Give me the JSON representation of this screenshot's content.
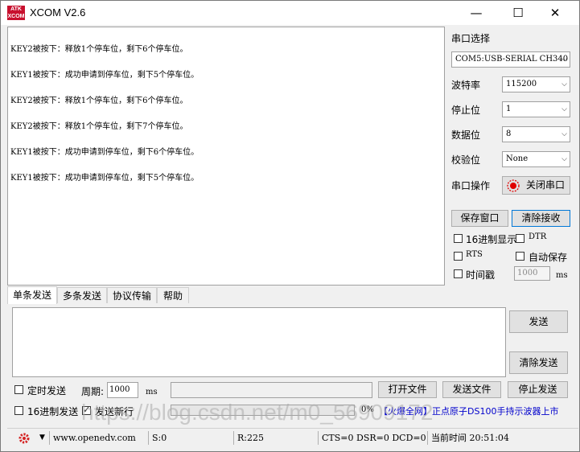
{
  "window": {
    "title": "XCOM V2.6",
    "icon_text": "ATK XCOM",
    "controls": [
      "—",
      "☐",
      "✕"
    ]
  },
  "receive_lines": [
    "KEY2被按下：释放1个停车位，剩下6个停车位。",
    "KEY1被按下：成功申请到停车位，剩下5个停车位。",
    "KEY2被按下：释放1个停车位，剩下6个停车位。",
    "KEY2被按下：释放1个停车位，剩下7个停车位。",
    "KEY1被按下：成功申请到停车位，剩下6个停车位。",
    "KEY1被按下：成功申请到停车位，剩下5个停车位。"
  ],
  "side": {
    "port_select_label": "串口选择",
    "port_value": "COM5:USB-SERIAL CH340",
    "baud_label": "波特率",
    "baud_value": "115200",
    "stop_label": "停止位",
    "stop_value": "1",
    "data_label": "数据位",
    "data_value": "8",
    "parity_label": "校验位",
    "parity_value": "None",
    "port_op_label": "串口操作",
    "close_port_label": "关闭串口",
    "save_window_label": "保存窗口",
    "clear_receive_label": "清除接收",
    "hex_display_label": "16进制显示",
    "dtr_label": "DTR",
    "rts_label": "RTS",
    "auto_save_label": "自动保存",
    "timestamp_label": "时间戳",
    "timestamp_value": "1000",
    "ms_label": "ms"
  },
  "tabs": [
    "单条发送",
    "多条发送",
    "协议传输",
    "帮助"
  ],
  "send": {
    "send_label": "发送",
    "clear_send_label": "清除发送",
    "timed_send_label": "定时发送",
    "period_label": "周期:",
    "period_value": "1000",
    "ms_label": "ms",
    "open_file_label": "打开文件",
    "send_file_label": "发送文件",
    "stop_send_label": "停止发送",
    "hex_send_label": "16进制发送",
    "send_newline_label": "发送新行",
    "progress_text": "0%",
    "progress": 0,
    "promo_text": "【火爆全网】正点原子DS100手持示波器上市"
  },
  "status": {
    "url": "www.openedv.com",
    "sent": "S:0",
    "received": "R:225",
    "signals": "CTS=0 DSR=0 DCD=0",
    "time": "当前时间 20:51:04"
  },
  "watermark": "https://blog.csdn.net/m0_56909172",
  "colors": {
    "close_indicator": "#e00000",
    "selected_border": "#0078d7",
    "promo": "#0000cc"
  }
}
